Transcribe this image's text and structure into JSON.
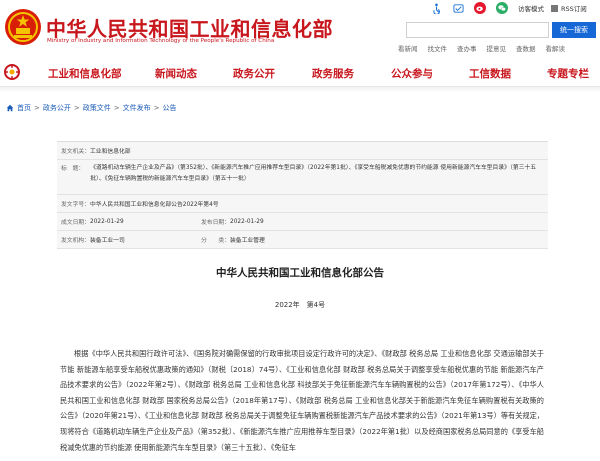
{
  "header": {
    "site_title": "中华人民共和国工业和信息化部",
    "site_subtitle": "Ministry of Industry and Information Technology of the People's Republic of China",
    "util_links": {
      "accessibility": "访客模式",
      "rss": "RSS订阅"
    },
    "search_button": "统一搜索",
    "quick_links": [
      "看新闻",
      "找文件",
      "查办事",
      "提意见",
      "查数据",
      "看解读"
    ]
  },
  "nav": {
    "items": [
      "工业和信息化部",
      "新闻动态",
      "政务公开",
      "政务服务",
      "公众参与",
      "工信数据",
      "专题专栏"
    ]
  },
  "breadcrumb": [
    "首页",
    "政务公开",
    "政策文件",
    "文件发布",
    "公告"
  ],
  "meta": {
    "issuer_label": "发文机关：",
    "issuer": "工业和信息化部",
    "title_label": "标　题：",
    "title": "《道路机动车辆生产企业及产品》（第352批）、《新能源汽车推广应用推荐车型目录》（2022年第1批）、《享受车船税减免优惠的节约能源 使用新能源汽车车型目录》（第三十五批）、《免征车辆购置税的新能源汽车车型目录》（第五十一批）",
    "doc_no_label": "发文字号：",
    "doc_no": "中华人民共和国工业和信息化部公告2022年第4号",
    "created_label": "成文日期：",
    "created": "2022-01-29",
    "published_label": "发布日期：",
    "published": "2022-01-29",
    "org_label": "发文机构：",
    "org": "装备工业一司",
    "category_label": "分　　类：",
    "category": "装备工业管理"
  },
  "article": {
    "title": "中华人民共和国工业和信息化部公告",
    "number": "2022年　第4号",
    "paragraph": "根据《中华人民共和国行政许可法》、《国务院对确需保留的行政审批项目设定行政许可的决定》、《财政部 税务总局 工业和信息化部 交通运输部关于节能 新能源车船享受车船税优惠政策的通知》（财税〔2018〕74号）、《工业和信息化部 财政部 税务总局关于调整享受车船税优惠的节能 新能源汽车产品技术要求的公告》（2022年第2号）、《财政部 税务总局 工业和信息化部 科技部关于免征新能源汽车车辆购置税的公告》（2017年第172号）、《中华人民共和国工业和信息化部 财政部 国家税务总局公告》（2018年第17号）、《财政部 税务总局 工业和信息化部关于新能源汽车免征车辆购置税有关政策的公告》（2020年第21号）、《工业和信息化部 财政部 税务总局关于调整免征车辆购置税新能源汽车产品技术要求的公告》（2021年第13号）等有关规定，现将符合《道路机动车辆生产企业及产品》（第352批）、《新能源汽车推广应用推荐车型目录》（2022年第1批）以及经商国家税务总局同意的《享受车船税减免优惠的节约能源 使用新能源汽车车型目录》（第三十五批）、《免征车"
  },
  "colors": {
    "brand_red": "#c8161d",
    "link_blue": "#1a5bb8",
    "search_blue": "#1668d6"
  },
  "icons": [
    "national-emblem-icon",
    "accessibility-icon",
    "weibo-icon",
    "wechat-icon",
    "rss-icon",
    "home-icon",
    "miit-logo-icon"
  ]
}
